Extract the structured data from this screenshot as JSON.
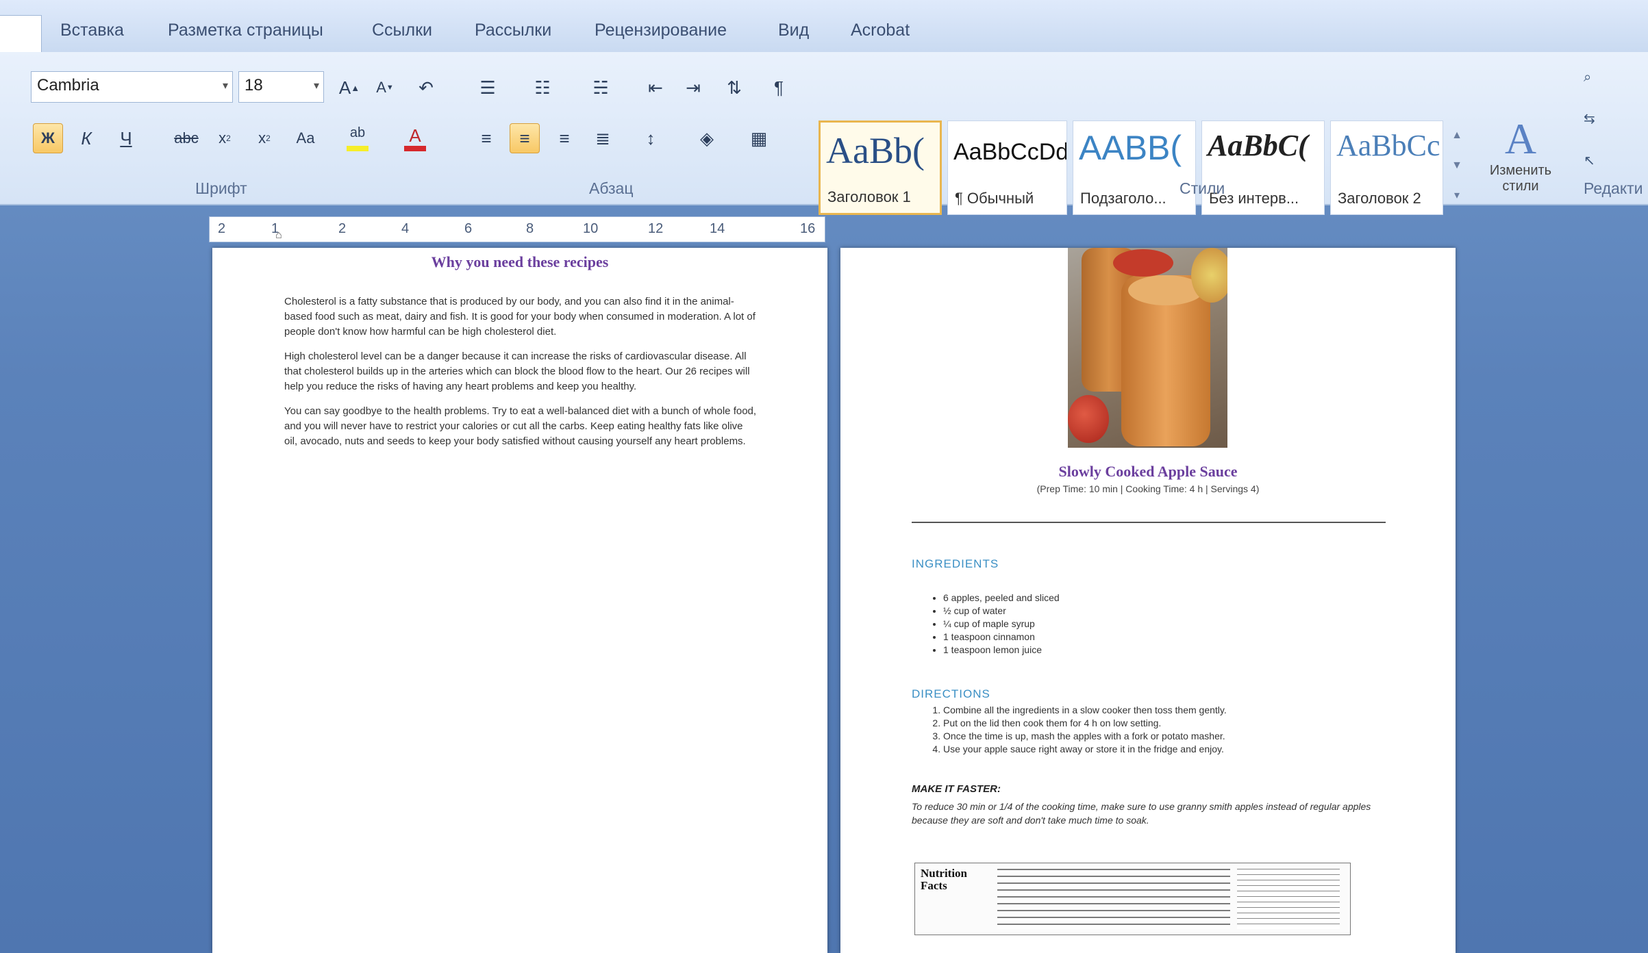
{
  "tabs": [
    "Вставка",
    "Разметка страницы",
    "Ссылки",
    "Рассылки",
    "Рецензирование",
    "Вид",
    "Acrobat"
  ],
  "font": {
    "family": "Cambria",
    "size": "18",
    "group_label": "Шрифт"
  },
  "paragraph": {
    "group_label": "Абзац"
  },
  "styles": {
    "group_label": "Стили",
    "change_label": "Изменить стили",
    "items": [
      {
        "preview": "AaBb(",
        "name": "Заголовок 1"
      },
      {
        "preview": "AaBbCcDd",
        "name": "¶ Обычный"
      },
      {
        "preview": "AABB(",
        "name": "Подзаголо..."
      },
      {
        "preview": "AaBbC(",
        "name": "Без интерв..."
      },
      {
        "preview": "AaBbCc",
        "name": "Заголовок 2"
      }
    ]
  },
  "editing": {
    "group_label": "Редакти"
  },
  "ruler": {
    "ticks": [
      "2",
      "1",
      "2",
      "4",
      "6",
      "8",
      "10",
      "12",
      "14",
      "16"
    ]
  },
  "page1": {
    "title": "Why you need these recipes",
    "paragraphs": [
      "Cholesterol is a fatty substance that is produced by our body, and you can also find it in the animal-based food such as meat, dairy and fish. It is good for your body when consumed in moderation. A lot of people don't know how harmful can be high cholesterol diet.",
      "High cholesterol level can be a danger because it can increase the risks of cardiovascular disease. All that cholesterol builds up in the arteries which can block the blood flow to the heart. Our 26 recipes will help you reduce the risks of having any heart problems and keep you healthy.",
      "You can say goodbye to the health problems. Try to eat a well-balanced diet with a bunch of whole food, and you will never have to restrict your calories or cut all the carbs. Keep eating healthy fats like olive oil, avocado, nuts and seeds to keep your body satisfied without causing yourself any heart problems."
    ]
  },
  "page2": {
    "recipe_title": "Slowly Cooked Apple Sauce",
    "meta": "(Prep Time: 10 min | Cooking Time: 4 h | Servings 4)",
    "ingredients_head": "INGREDIENTS",
    "ingredients": [
      "6 apples, peeled and sliced",
      "½ cup of water",
      "¼ cup of maple syrup",
      "1 teaspoon cinnamon",
      "1 teaspoon lemon juice"
    ],
    "directions_head": "DIRECTIONS",
    "directions": [
      "Combine all the ingredients in a slow cooker then toss them gently.",
      "Put on the lid then cook them for 4 h on low setting.",
      "Once the time is up, mash the apples with a fork or potato masher.",
      "Use your apple sauce right away or store it in the fridge and enjoy."
    ],
    "tip_head": "MAKE IT FASTER:",
    "tip_text": "To reduce 30 min or 1/4 of the cooking time, make sure to use granny smith apples instead of regular apples because they are soft and don't take much time to soak.",
    "nutrition_label": "Nutrition Facts"
  }
}
